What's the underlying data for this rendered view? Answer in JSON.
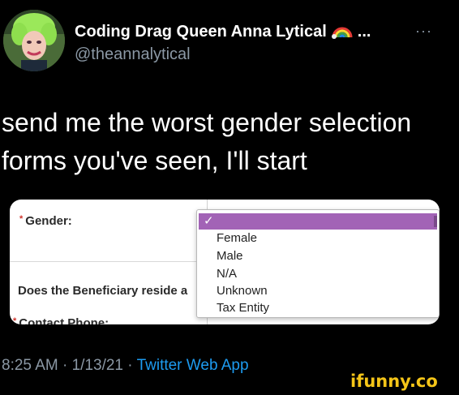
{
  "user": {
    "display_name": "Coding Drag Queen Anna Lytical",
    "truncation": "...",
    "handle": "@theannalytical",
    "more_label": "···"
  },
  "tweet": {
    "lines": [
      "send me the worst gender selection",
      "forms you've seen, I'll start"
    ]
  },
  "form": {
    "required_mark": "*",
    "gender_label": "Gender:",
    "beneficiary_label": "Does the Beneficiary reside a",
    "contact_label": "Contact Phone:",
    "check_mark": "✓",
    "options": [
      "Female",
      "Male",
      "N/A",
      "Unknown",
      "Tax Entity"
    ],
    "selected_color": "#a263b6"
  },
  "meta": {
    "time": "8:25 AM",
    "sep": "·",
    "date": "1/13/21",
    "source": "Twitter Web App"
  },
  "watermark": {
    "text": "ifunny.co",
    "color": "#f5c518"
  },
  "icons": {
    "avatar": "avatar",
    "rainbow": "rainbow-emoji-icon",
    "more": "more-icon"
  }
}
